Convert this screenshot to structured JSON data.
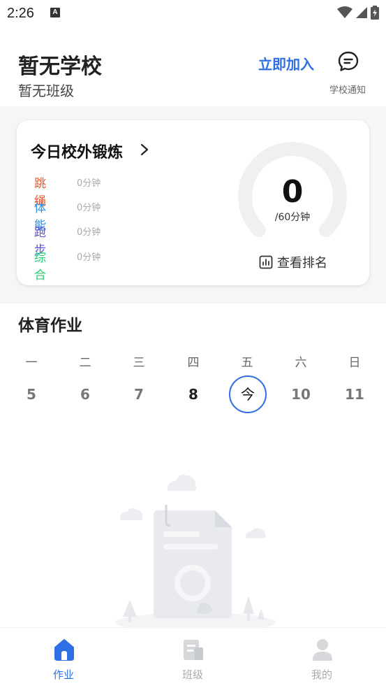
{
  "status_bar": {
    "time": "2:26",
    "notif_glyph": "A"
  },
  "header": {
    "school": "暂无学校",
    "class": "暂无班级",
    "join_label": "立即加入",
    "notice_label": "学校通知",
    "notice_icon": "chat-bubble-icon"
  },
  "exercise": {
    "title": "今日校外锻炼",
    "items": [
      {
        "name": "跳绳",
        "time": "0分钟",
        "color": "#e8572e"
      },
      {
        "name": "体能",
        "time": "0分钟",
        "color": "#2e8fe0"
      },
      {
        "name": "跑步",
        "time": "0分钟",
        "color": "#5b52d6"
      },
      {
        "name": "综合",
        "time": "0分钟",
        "color": "#2dc97a"
      }
    ],
    "total_minutes": "0",
    "target_label": "/60分钟",
    "progress": 0,
    "rank_label": "查看排名"
  },
  "homework": {
    "title": "体育作业",
    "weekdays": [
      "一",
      "二",
      "三",
      "四",
      "五",
      "六",
      "日"
    ],
    "days": [
      "5",
      "6",
      "7",
      "8",
      "今",
      "10",
      "11"
    ],
    "today_index": 4,
    "current_index": 3,
    "accent": "#2f6fe4"
  },
  "bottom_nav": [
    {
      "label": "作业",
      "icon": "home-icon",
      "active": true
    },
    {
      "label": "班级",
      "icon": "class-icon",
      "active": false
    },
    {
      "label": "我的",
      "icon": "user-icon",
      "active": false
    }
  ]
}
